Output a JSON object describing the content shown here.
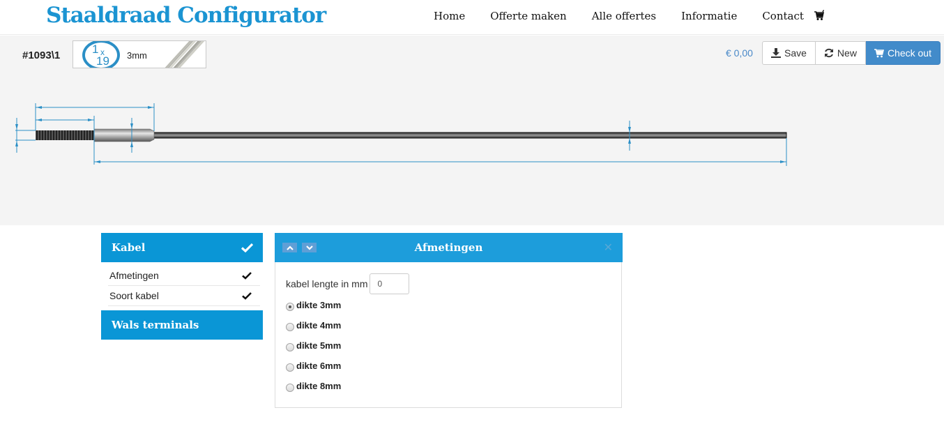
{
  "header": {
    "brand": "Staaldraad Configurator",
    "nav": [
      "Home",
      "Offerte maken",
      "Alle offertes",
      "Informatie",
      "Contact"
    ],
    "cart_icon": "shopping-cart-icon"
  },
  "toolbar": {
    "order_id": "#1093\\1",
    "cable": {
      "badge_top": "1",
      "badge_x": "x",
      "badge_bottom": "19",
      "size": "3mm"
    },
    "price": "€ 0,00",
    "save_label": "Save",
    "new_label": "New",
    "checkout_label": "Check out"
  },
  "colors": {
    "brand": "#1b94d2",
    "panel_header": "#0a96d6",
    "primary_button": "#428bca",
    "dimension_line": "#2b8fc6"
  },
  "sidebar": {
    "sections": [
      {
        "title": "Kabel",
        "completed": true,
        "items": [
          {
            "label": "Afmetingen",
            "completed": true
          },
          {
            "label": "Soort kabel",
            "completed": true
          }
        ]
      },
      {
        "title": "Wals terminals",
        "completed": false,
        "items": []
      }
    ]
  },
  "main_panel": {
    "title": "Afmetingen",
    "length_label": "kabel lengte in mm",
    "length_value": "0",
    "thickness_options": [
      {
        "label": "dikte 3mm",
        "selected": true
      },
      {
        "label": "dikte 4mm",
        "selected": false
      },
      {
        "label": "dikte 5mm",
        "selected": false
      },
      {
        "label": "dikte 6mm",
        "selected": false
      },
      {
        "label": "dikte 8mm",
        "selected": false
      }
    ]
  }
}
